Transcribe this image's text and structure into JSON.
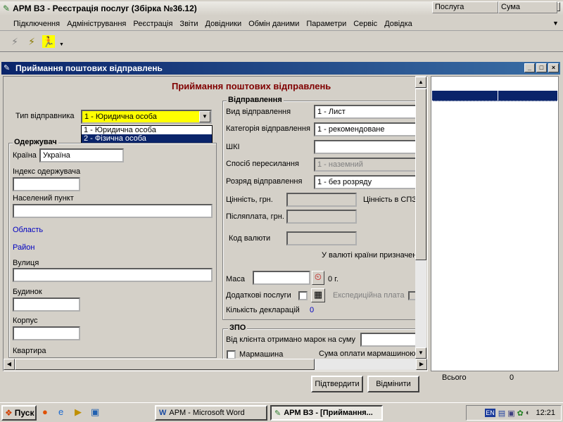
{
  "app": {
    "title": "АРМ ВЗ - Реєстрація послуг (Збірка №36.12)"
  },
  "menu": [
    "Підключення",
    "Адміністрування",
    "Реєстрація",
    "Звіти",
    "Довідники",
    "Обмін даними",
    "Параметри",
    "Сервіс",
    "Довідка"
  ],
  "child_window": {
    "title": "Приймання поштових відправлень",
    "heading": "Приймання поштових відправлень"
  },
  "sender_type": {
    "label": "Тип відправника",
    "value": "1 - Юридична особа",
    "options": [
      "1 - Юридична особа",
      "2 - Фізична особа"
    ]
  },
  "recipient": {
    "group": "Одержувач",
    "country_label": "Країна",
    "country_value": "Україна",
    "index_label": "Індекс одержувача",
    "city_label": "Населений пункт",
    "region_label": "Область",
    "district_label": "Район",
    "street_label": "Вулиця",
    "building_label": "Будинок",
    "block_label": "Корпус",
    "apt_label": "Квартира"
  },
  "shipment": {
    "group": "Відправлення",
    "type_label": "Вид відправлення",
    "type_value": "1 - Лист",
    "category_label": "Категорія відправлення",
    "category_value": "1 - рекомендоване",
    "shki_label": "ШКІ",
    "method_label": "Спосіб пересилання",
    "method_value": "1 - наземний",
    "rank_label": "Розряд відправлення",
    "rank_value": "1 - без розряду",
    "value_label": "Цінність, грн.",
    "value_sdr_label": "Цінність в СПЗ",
    "cod_label": "Післяплата, грн.",
    "currency_label": "Код валюти",
    "dest_currency_label": "У валюті країни призначен",
    "mass_label": "Маса",
    "mass_unit": "0 г.",
    "extra_label": "Додаткові послуги",
    "expedition_label": "Експедиційна плата",
    "decl_label": "Кількість декларацій",
    "decl_value": "0"
  },
  "zpo": {
    "group": "ЗПО",
    "stamps_label": "Від клієнта отримано марок на суму",
    "franking_label": "Мармашина",
    "franking_sum_label": "Сума оплати мармашиною"
  },
  "grid": {
    "col1": "Послуга",
    "col2": "Сума",
    "total_label": "Всього",
    "total_value": "0"
  },
  "buttons": {
    "confirm": "Підтвердити",
    "cancel": "Відмінити"
  },
  "taskbar": {
    "start": "Пуск",
    "tasks": [
      "АРМ - Microsoft Word",
      "АРМ ВЗ - [Приймання..."
    ],
    "lang": "EN",
    "time": "12:21"
  },
  "colors": {
    "accent": "#0a246a",
    "heading": "#800000",
    "link": "#0000c0",
    "combo_highlight": "#ffff00"
  }
}
